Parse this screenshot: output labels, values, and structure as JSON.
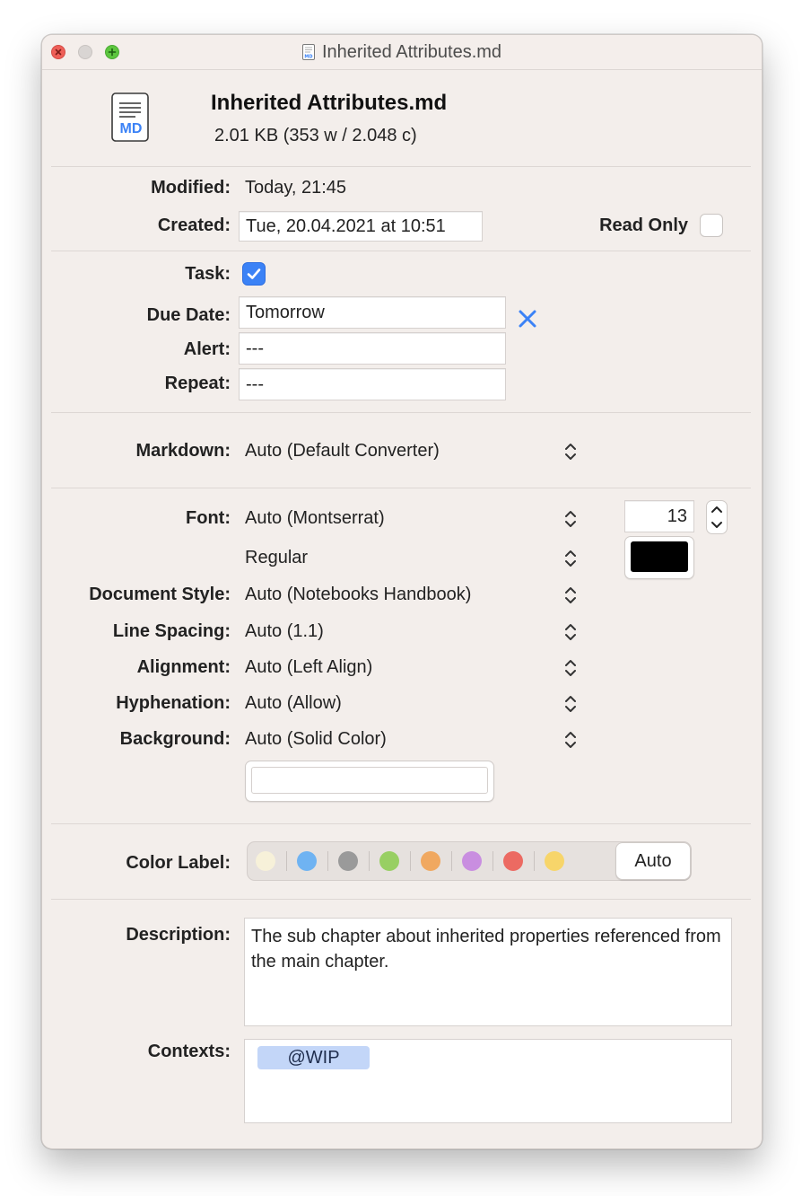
{
  "window": {
    "title": "Inherited Attributes.md"
  },
  "header": {
    "file_name": "Inherited Attributes.md",
    "file_stats": "2.01 KB (353 w / 2.048 c)",
    "doc_icon_text": "MD"
  },
  "dates": {
    "modified_label": "Modified:",
    "modified_value": "Today, 21:45",
    "created_label": "Created:",
    "created_value": "Tue, 20.04.2021 at 10:51",
    "read_only_label": "Read Only",
    "read_only_checked": false
  },
  "task": {
    "task_label": "Task:",
    "task_checked": true,
    "due_label": "Due Date:",
    "due_value": "Tomorrow",
    "alert_label": "Alert:",
    "alert_value": "---",
    "repeat_label": "Repeat:",
    "repeat_value": "---"
  },
  "markdown": {
    "label": "Markdown:",
    "value": "Auto (Default Converter)"
  },
  "style": {
    "font_label": "Font:",
    "font_value": "Auto (Montserrat)",
    "font_size": "13",
    "font_weight_value": "Regular",
    "font_color": "#000000",
    "doc_style_label": "Document Style:",
    "doc_style_value": "Auto (Notebooks Handbook)",
    "line_spacing_label": "Line Spacing:",
    "line_spacing_value": "Auto (1.1)",
    "alignment_label": "Alignment:",
    "alignment_value": "Auto (Left Align)",
    "hyphenation_label": "Hyphenation:",
    "hyphenation_value": "Auto (Allow)",
    "background_label": "Background:",
    "background_value": "Auto (Solid Color)",
    "background_color": "#ffffff"
  },
  "color_label": {
    "label": "Color Label:",
    "colors": [
      "#f7f1d9",
      "#6fb3f2",
      "#9a9a9a",
      "#98cf63",
      "#f0a860",
      "#c98ee0",
      "#ec6a62",
      "#f7d56a"
    ],
    "auto_label": "Auto"
  },
  "description": {
    "label": "Description:",
    "text": "The sub chapter about inherited properties referenced from the main chapter."
  },
  "contexts": {
    "label": "Contexts:",
    "tokens": [
      "@WIP"
    ]
  },
  "colors": {
    "accent": "#3b82f6",
    "window_bg": "#f3eeeb"
  }
}
